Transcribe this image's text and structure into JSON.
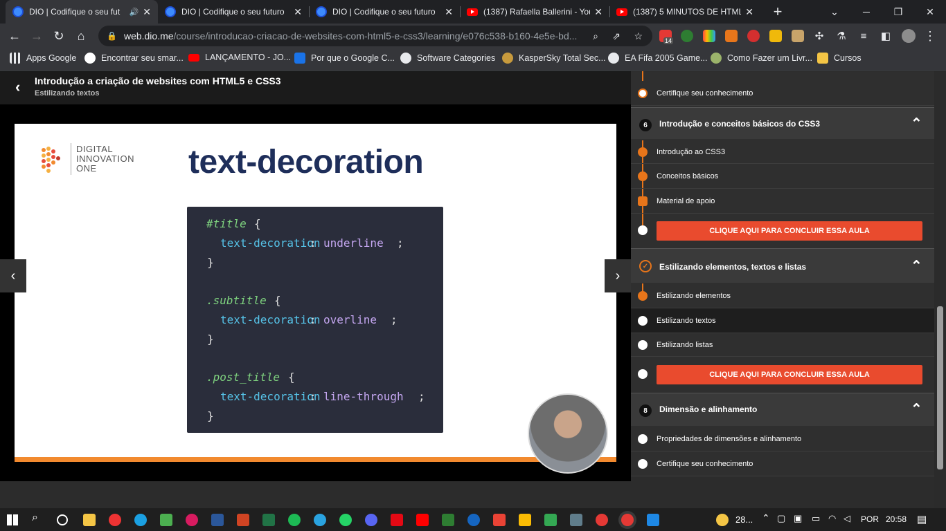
{
  "tabs": [
    {
      "title": "DIO | Codifique o seu fut",
      "icon": "dio-icon",
      "audio": true
    },
    {
      "title": "DIO | Codifique o seu futuro",
      "icon": "dio-icon"
    },
    {
      "title": "DIO | Codifique o seu futuro",
      "icon": "dio-icon"
    },
    {
      "title": "(1387) Rafaella Ballerini - You",
      "icon": "youtube-icon"
    },
    {
      "title": "(1387) 5 MINUTOS DE HTML",
      "icon": "youtube-icon"
    }
  ],
  "address": {
    "domain": "web.dio.me",
    "path": "/course/introducao-criacao-de-websites-com-html5-e-css3/learning/e076c538-b160-4e5e-bd..."
  },
  "extensions": {
    "badge": "14"
  },
  "bookmarks": [
    {
      "label": "Apps Google"
    },
    {
      "label": "Encontrar seu smar..."
    },
    {
      "label": "LANÇAMENTO - JO..."
    },
    {
      "label": "Por que o Google C..."
    },
    {
      "label": "Software Categories"
    },
    {
      "label": "KasperSky Total Sec..."
    },
    {
      "label": "EA Fifa 2005 Game..."
    },
    {
      "label": "Como Fazer um Livr..."
    },
    {
      "label": "Cursos"
    }
  ],
  "course": {
    "title": "Introdução a criação de websites com HTML5 e CSS3",
    "lesson": "Estilizando textos"
  },
  "slide": {
    "brand_line1": "DIGITAL",
    "brand_line2": "INNOVATION",
    "brand_line3": "ONE",
    "heading": "text-decoration",
    "code": [
      {
        "sel": "#title",
        "prop": "text-decoration",
        "val": "underline"
      },
      {
        "sel": ".subtitle",
        "prop": "text-decoration",
        "val": "overline"
      },
      {
        "sel": ".post_title",
        "prop": "text-decoration",
        "val": "line-through"
      }
    ],
    "brace_open": "{",
    "brace_close": "}"
  },
  "sidebar": {
    "prev_item": "Certifique seu conhecimento",
    "section6": {
      "num": "6",
      "title": "Introdução e conceitos básicos do CSS3",
      "items": [
        "Introdução ao CSS3",
        "Conceitos básicos",
        "Material de apoio"
      ],
      "cta": "CLIQUE AQUI PARA CONCLUIR ESSA AULA"
    },
    "section7": {
      "title": "Estilizando elementos, textos e listas",
      "items": [
        "Estilizando elementos",
        "Estilizando textos",
        "Estilizando listas"
      ],
      "cta": "CLIQUE AQUI PARA CONCLUIR ESSA AULA"
    },
    "section8": {
      "num": "8",
      "title": "Dimensão e alinhamento",
      "items": [
        "Propriedades de dimensões e alinhamento",
        "Certifique seu conhecimento"
      ]
    }
  },
  "taskbar": {
    "weather": "28...",
    "lang": "POR",
    "time": "20:58"
  },
  "colors": {
    "accent": "#e94b2e",
    "orange": "#f28a2f",
    "brand_blue": "#1e2e5a"
  }
}
